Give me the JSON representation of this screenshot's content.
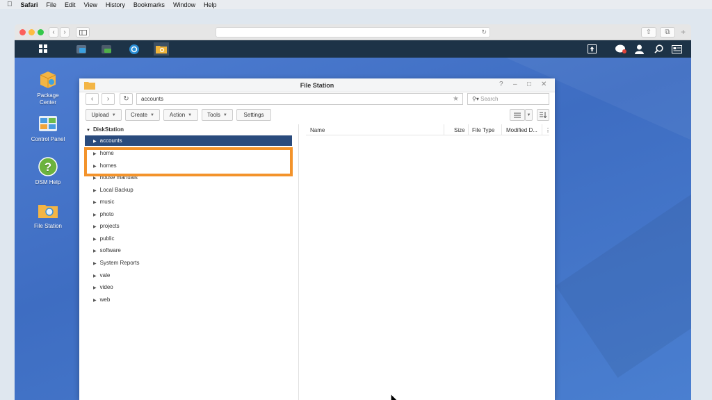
{
  "menubar": {
    "app": "Safari",
    "items": [
      "File",
      "Edit",
      "View",
      "History",
      "Bookmarks",
      "Window",
      "Help"
    ]
  },
  "desktop_icons": [
    {
      "label_lines": [
        "Package",
        "Center"
      ],
      "icon": "package-center-icon"
    },
    {
      "label_lines": [
        "Control Panel"
      ],
      "icon": "control-panel-icon"
    },
    {
      "label_lines": [
        "DSM Help"
      ],
      "icon": "help-icon"
    },
    {
      "label_lines": [
        "File Station"
      ],
      "icon": "folder-search-icon"
    }
  ],
  "file_station": {
    "title": "File Station",
    "path_value": "accounts",
    "search_placeholder": "Search",
    "toolbar": {
      "upload": "Upload",
      "create": "Create",
      "action": "Action",
      "tools": "Tools",
      "settings": "Settings"
    },
    "tree": {
      "root": "DiskStation",
      "items": [
        "accounts",
        "home",
        "homes",
        "house manuals",
        "Local Backup",
        "music",
        "photo",
        "projects",
        "public",
        "software",
        "System Reports",
        "vale",
        "video",
        "web"
      ],
      "selected": "accounts"
    },
    "columns": [
      "Name",
      "Size",
      "File Type",
      "Modified D..."
    ]
  },
  "colors": {
    "selection": "#2a4b7d",
    "highlight": "#f3932b",
    "taskbar": "#1d3347",
    "desktop": "#4a7acb"
  }
}
